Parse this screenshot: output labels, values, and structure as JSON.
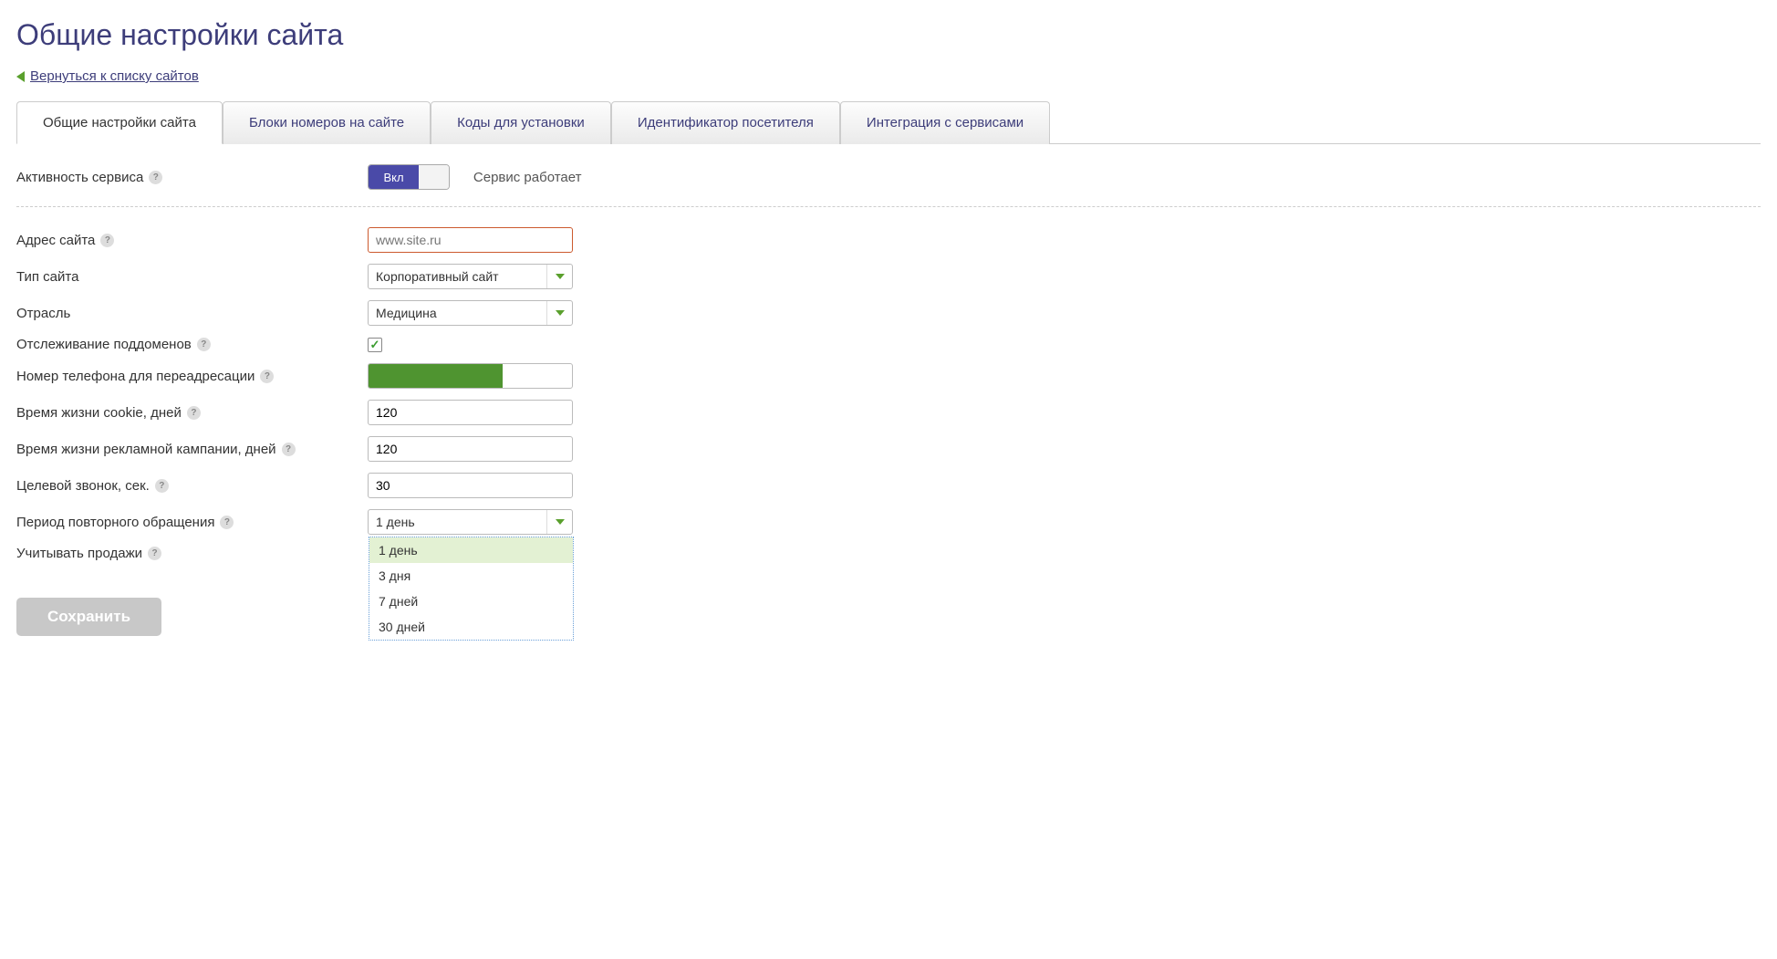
{
  "page": {
    "title": "Общие настройки сайта",
    "back_link": "Вернуться к списку сайтов"
  },
  "tabs": [
    "Общие настройки сайта",
    "Блоки номеров на сайте",
    "Коды для установки",
    "Идентификатор посетителя",
    "Интеграция с сервисами"
  ],
  "form": {
    "activity_label": "Активность сервиса",
    "toggle_on": "Вкл",
    "status_text": "Сервис работает",
    "site_address_label": "Адрес сайта",
    "site_address_placeholder": "www.site.ru",
    "site_type_label": "Тип сайта",
    "site_type_value": "Корпоративный сайт",
    "industry_label": "Отрасль",
    "industry_value": "Медицина",
    "subdomain_label": "Отслеживание поддоменов",
    "phone_label": "Номер телефона для переадресации",
    "cookie_label": "Время жизни cookie, дней",
    "cookie_value": "120",
    "campaign_label": "Время жизни рекламной кампании, дней",
    "campaign_value": "120",
    "target_call_label": "Целевой звонок, сек.",
    "target_call_value": "30",
    "repeat_label": "Период повторного обращения",
    "repeat_value": "1 день",
    "repeat_options": [
      "1 день",
      "3 дня",
      "7 дней",
      "30 дней"
    ],
    "sales_label": "Учитывать продажи",
    "save_button": "Сохранить"
  }
}
